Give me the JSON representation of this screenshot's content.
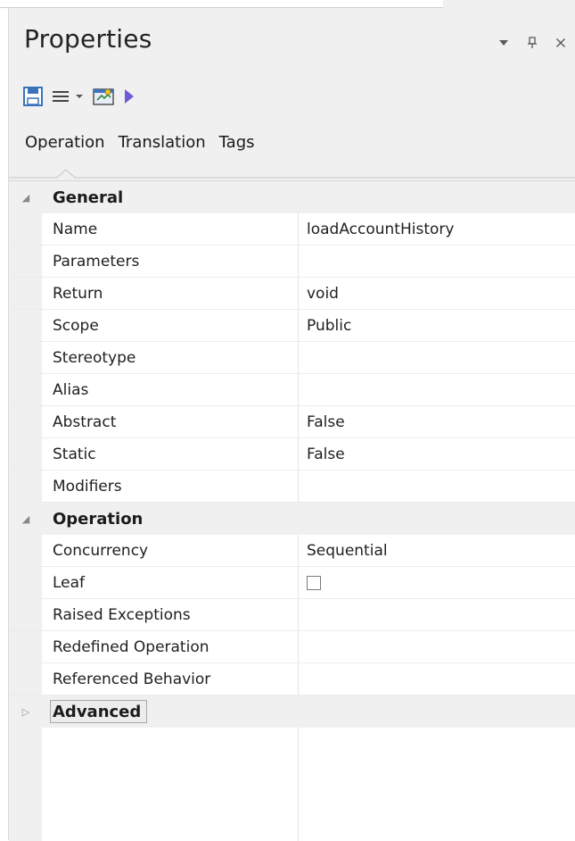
{
  "panel": {
    "title": "Properties",
    "controls": {
      "dropdown_glyph": "▾",
      "pin_glyph": "⊥",
      "close_glyph": "×"
    }
  },
  "toolbar": {
    "items": [
      {
        "icon": "save-icon"
      },
      {
        "icon": "list-menu-icon"
      },
      {
        "icon": "properties-dialog-icon"
      },
      {
        "icon": "play-icon"
      }
    ]
  },
  "tabs": [
    "Operation",
    "Translation",
    "Tags"
  ],
  "groups": [
    {
      "label": "General",
      "expanded": true,
      "rows": [
        {
          "name": "Name",
          "value": "loadAccountHistory"
        },
        {
          "name": "Parameters",
          "value": ""
        },
        {
          "name": "Return",
          "value": "void"
        },
        {
          "name": "Scope",
          "value": "Public"
        },
        {
          "name": "Stereotype",
          "value": ""
        },
        {
          "name": "Alias",
          "value": ""
        },
        {
          "name": "Abstract",
          "value": "False"
        },
        {
          "name": "Static",
          "value": "False"
        },
        {
          "name": "Modifiers",
          "value": ""
        }
      ]
    },
    {
      "label": "Operation",
      "expanded": true,
      "rows": [
        {
          "name": "Concurrency",
          "value": "Sequential"
        },
        {
          "name": "Leaf",
          "value": "",
          "checkbox": true,
          "checked": false
        },
        {
          "name": "Raised Exceptions",
          "value": ""
        },
        {
          "name": "Redefined Operation",
          "value": ""
        },
        {
          "name": "Referenced Behavior",
          "value": ""
        }
      ]
    },
    {
      "label": "Advanced",
      "expanded": false,
      "rows": []
    }
  ],
  "colors": {
    "panel_bg": "#f0f0f0",
    "grid_bg": "#ffffff",
    "accent_blue": "#3b73b9",
    "play_purple": "#6b5bd6"
  }
}
